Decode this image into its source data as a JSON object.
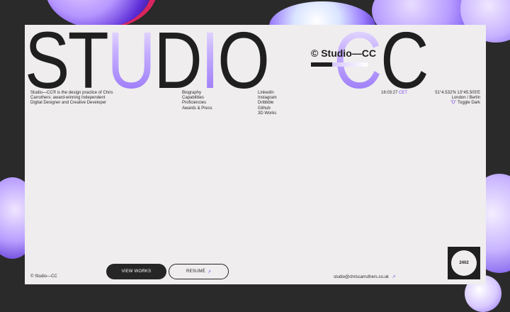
{
  "hero": {
    "letters": [
      "S",
      "T",
      "U",
      "D",
      "I",
      "O",
      "—",
      "C",
      "C"
    ],
    "mark": "© Studio—CC"
  },
  "intro": "Studio—CC® is the design practice of Chris Carruthers: award-winning Independent Digital Designer and Creative Developer",
  "nav": {
    "items": [
      "Biography",
      "Capabilities",
      "Proficiencies",
      "Awards & Press"
    ]
  },
  "social": {
    "items": [
      "LinkedIn",
      "Instagram",
      "Dribbble",
      "Github",
      "3D Works"
    ]
  },
  "clock": {
    "time": "16:03:27",
    "zone": "CET"
  },
  "location": {
    "coords": "51°4.532'N 13°45.505'E",
    "cities": "London / Berlin",
    "toggle_key": "\"D\"",
    "toggle_label": "Toggle Dark"
  },
  "footer": {
    "mark": "© Studio—CC",
    "view_works": "VIEW WORKS",
    "resume": "RESUMÉ",
    "email": "studio@chriscarruthers.co.uk",
    "badge": "2402"
  },
  "colors": {
    "background": "#2a2a2a",
    "panel": "#efedee",
    "ink": "#1f1f1f",
    "accent": "#7a47ef"
  },
  "icons": {
    "arrow": "arrow-up-right-icon"
  }
}
